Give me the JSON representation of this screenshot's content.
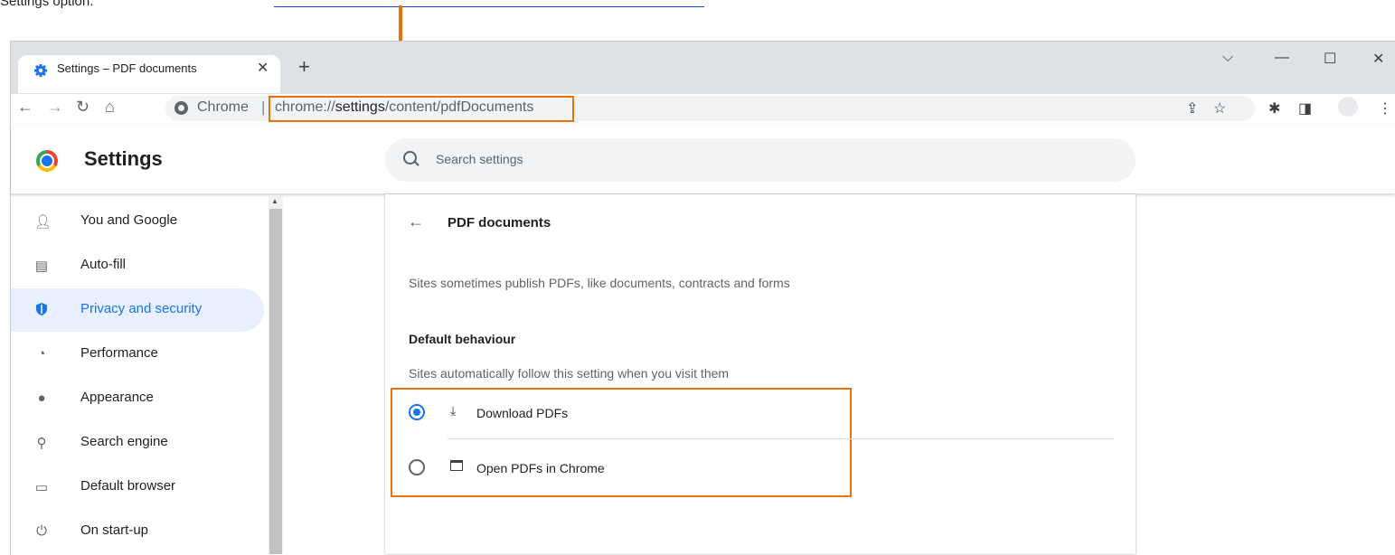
{
  "instruction": {
    "prefix": "Settings option:",
    "link": "chrome://settings/content/pdfDocuments"
  },
  "browser": {
    "tab_title": "Settings – PDF documents",
    "chrome_label": "Chrome",
    "url_plain": "chrome://",
    "url_bold": "settings",
    "url_rest": "/content/pdfDocuments",
    "highlight_color": "#e8730c"
  },
  "header": {
    "title": "Settings",
    "search_placeholder": "Search settings"
  },
  "sidebar": {
    "items": [
      {
        "label": "You and Google",
        "icon": "person-icon"
      },
      {
        "label": "Auto-fill",
        "icon": "clipboard-icon"
      },
      {
        "label": "Privacy and security",
        "icon": "shield-icon",
        "active": true
      },
      {
        "label": "Performance",
        "icon": "speedometer-icon"
      },
      {
        "label": "Appearance",
        "icon": "palette-icon"
      },
      {
        "label": "Search engine",
        "icon": "search-icon"
      },
      {
        "label": "Default browser",
        "icon": "browser-icon"
      },
      {
        "label": "On start-up",
        "icon": "power-icon"
      }
    ]
  },
  "main": {
    "title": "PDF documents",
    "description": "Sites sometimes publish PDFs, like documents, contracts and forms",
    "section_title": "Default behaviour",
    "section_description": "Sites automatically follow this setting when you visit them",
    "options": [
      {
        "label": "Download PDFs",
        "icon": "download-icon",
        "selected": true
      },
      {
        "label": "Open PDFs in Chrome",
        "icon": "open-in-browser-icon",
        "selected": false
      }
    ]
  }
}
